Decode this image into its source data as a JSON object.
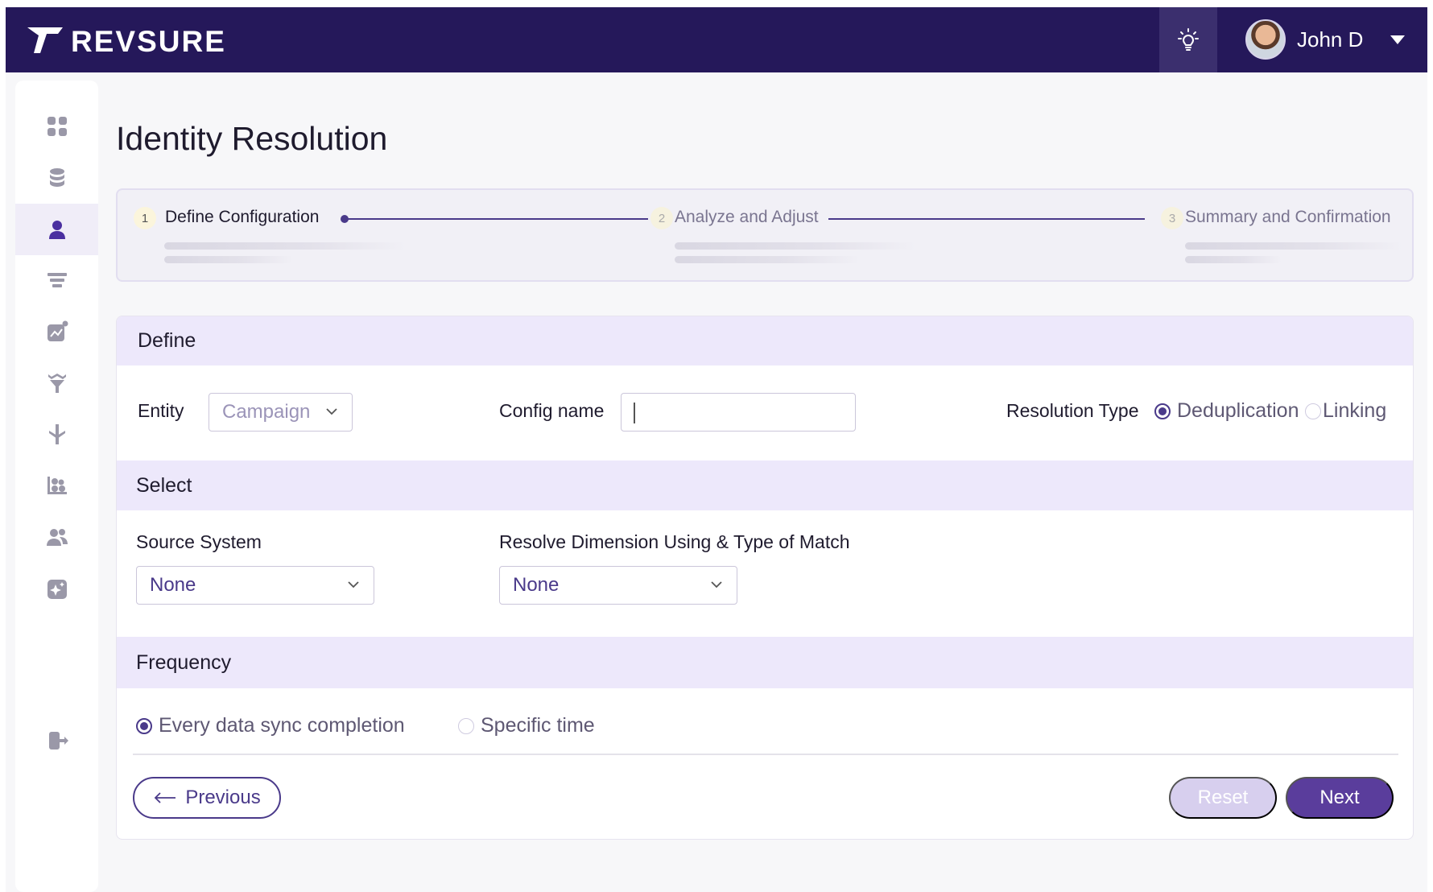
{
  "brand": {
    "name": "REVSURE"
  },
  "header": {
    "user_name": "John D"
  },
  "sidebar": {
    "items": [
      {
        "icon": "dashboard-grid-icon"
      },
      {
        "icon": "database-icon"
      },
      {
        "icon": "user-icon",
        "active": true
      },
      {
        "icon": "funnel-stack-icon"
      },
      {
        "icon": "analytics-chart-icon"
      },
      {
        "icon": "filter-funnel-icon"
      },
      {
        "icon": "merge-arrow-icon"
      },
      {
        "icon": "segments-icon"
      },
      {
        "icon": "team-icon"
      },
      {
        "icon": "sparkle-icon"
      }
    ],
    "logout_icon": "logout-icon"
  },
  "page": {
    "title": "Identity Resolution"
  },
  "stepper": {
    "steps": [
      {
        "num": "1",
        "label": "Define Configuration"
      },
      {
        "num": "2",
        "label": "Analyze and Adjust"
      },
      {
        "num": "3",
        "label": "Summary and Confirmation"
      }
    ]
  },
  "define": {
    "heading": "Define",
    "entity_label": "Entity",
    "entity_value": "Campaign",
    "config_label": "Config name",
    "config_value": "",
    "resolution_label": "Resolution Type",
    "resolution_options": [
      "Deduplication",
      "Linking"
    ],
    "resolution_selected": "Deduplication"
  },
  "select": {
    "heading": "Select",
    "source_label": "Source System",
    "source_value": "None",
    "resolve_label": "Resolve Dimension Using & Type of Match",
    "resolve_value": "None"
  },
  "frequency": {
    "heading": "Frequency",
    "options": [
      "Every data sync completion",
      "Specific time"
    ],
    "selected": "Every data sync completion"
  },
  "actions": {
    "previous": "Previous",
    "reset": "Reset",
    "next": "Next"
  },
  "colors": {
    "primary": "#5a3d9c",
    "topbar": "#25185a",
    "section_bg": "#ede8fb"
  }
}
